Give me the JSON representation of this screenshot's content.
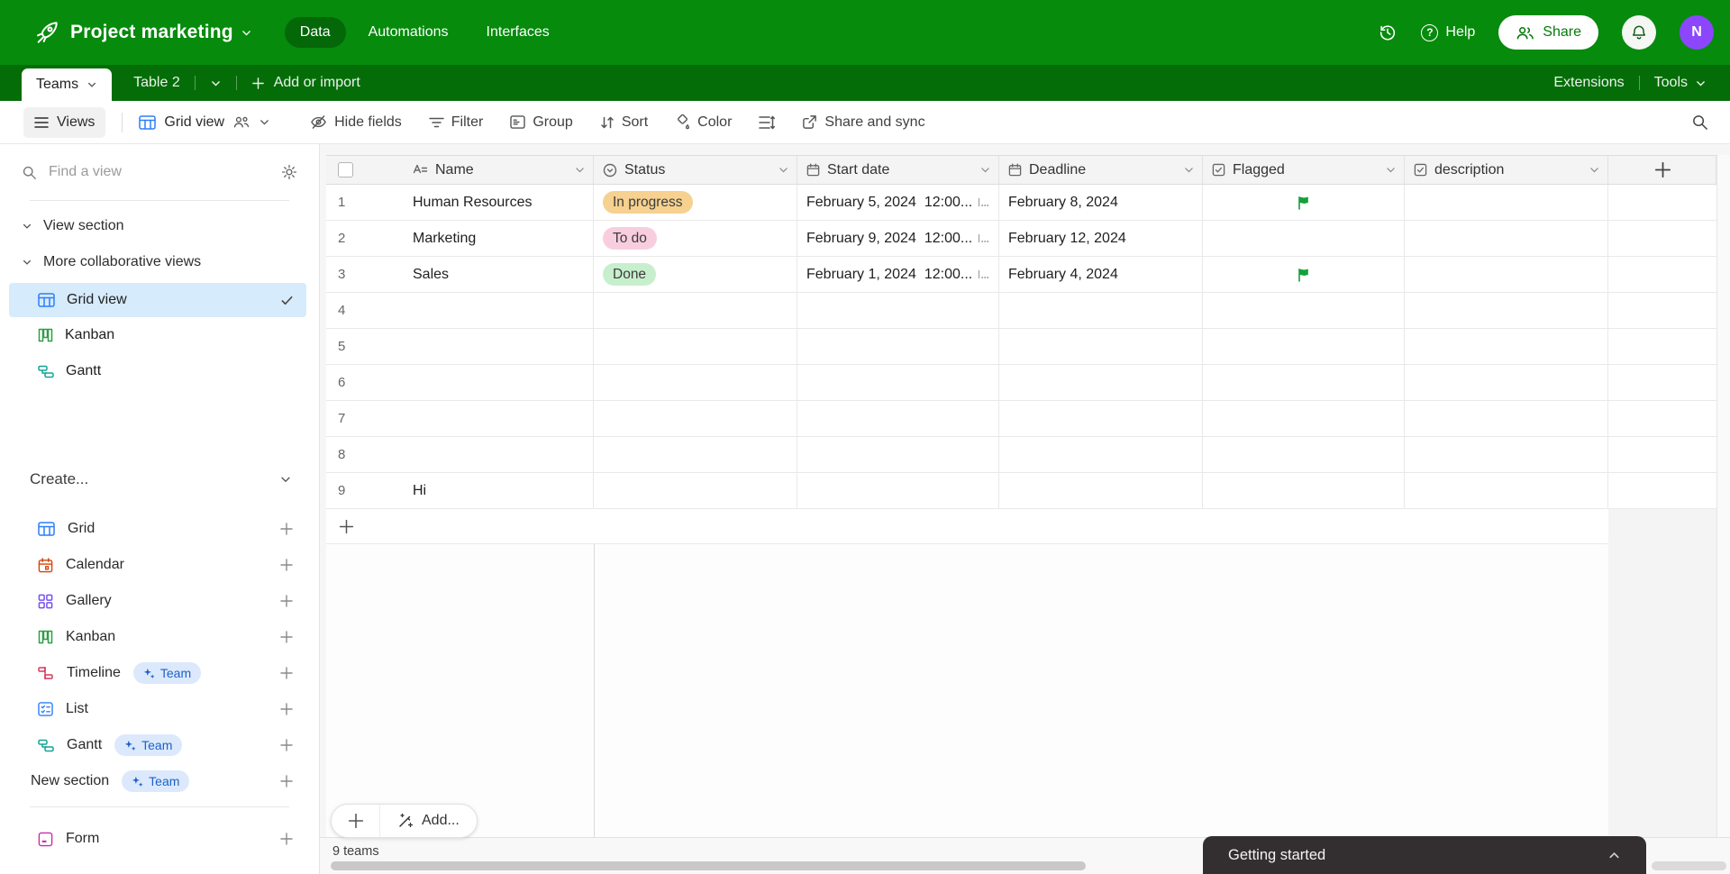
{
  "colors": {
    "topbar_green": "#068b0c",
    "tabbar_green": "#056d08",
    "selected_view_bg": "#d6ebfc",
    "status_in_progress_bg": "#f6d18f",
    "status_todo_bg": "#f8cede",
    "status_done_bg": "#c8efcd",
    "flag_green": "#15a03c",
    "avatar_purple": "#8b46fe",
    "team_badge_bg": "#dce9fc",
    "team_badge_text": "#1b61c9",
    "grid_icon_blue": "#2d7ff9",
    "kanban_icon_green": "#2f9e44",
    "gantt_icon_teal": "#12a594",
    "calendar_icon_orange": "#d54309",
    "gallery_icon_purple": "#7950f2",
    "timeline_icon_red": "#d6395f",
    "form_icon_magenta": "#cc2ab1"
  },
  "topbar": {
    "title": "Project marketing",
    "nav": [
      {
        "label": "Data",
        "active": true
      },
      {
        "label": "Automations",
        "active": false
      },
      {
        "label": "Interfaces",
        "active": false
      }
    ],
    "help_label": "Help",
    "share_label": "Share",
    "avatar_initial": "N"
  },
  "tabbar": {
    "active_table": "Teams",
    "second_table": "Table 2",
    "add_or_import_label": "Add or import",
    "extensions_label": "Extensions",
    "tools_label": "Tools"
  },
  "toolbar": {
    "views_label": "Views",
    "view_name": "Grid view",
    "hide_fields_label": "Hide fields",
    "filter_label": "Filter",
    "group_label": "Group",
    "sort_label": "Sort",
    "color_label": "Color",
    "share_sync_label": "Share and sync"
  },
  "sidebar": {
    "search_placeholder": "Find a view",
    "sections": [
      {
        "label": "View section"
      },
      {
        "label": "More collaborative views"
      }
    ],
    "views": [
      {
        "label": "Grid view",
        "selected": true
      },
      {
        "label": "Kanban",
        "selected": false
      },
      {
        "label": "Gantt",
        "selected": false
      }
    ],
    "create_label": "Create...",
    "create_items": [
      {
        "label": "Grid"
      },
      {
        "label": "Calendar"
      },
      {
        "label": "Gallery"
      },
      {
        "label": "Kanban"
      },
      {
        "label": "Timeline",
        "badge": "Team"
      },
      {
        "label": "List"
      },
      {
        "label": "Gantt",
        "badge": "Team"
      },
      {
        "label": "New section",
        "badge": "Team"
      },
      {
        "label": "Form"
      }
    ]
  },
  "table": {
    "columns": [
      "Name",
      "Status",
      "Start date",
      "Deadline",
      "Flagged",
      "description"
    ],
    "rows": [
      {
        "num": "1",
        "name": "Human Resources",
        "status": "In progress",
        "start_date": "February 5, 2024",
        "start_time": "12:00...",
        "deadline": "February 8, 2024",
        "flagged": true
      },
      {
        "num": "2",
        "name": "Marketing",
        "status": "To do",
        "start_date": "February 9, 2024",
        "start_time": "12:00...",
        "deadline": "February 12, 2024",
        "flagged": false
      },
      {
        "num": "3",
        "name": "Sales",
        "status": "Done",
        "start_date": "February 1, 2024",
        "start_time": "12:00...",
        "deadline": "February 4, 2024",
        "flagged": true
      },
      {
        "num": "4"
      },
      {
        "num": "5"
      },
      {
        "num": "6"
      },
      {
        "num": "7"
      },
      {
        "num": "8"
      },
      {
        "num": "9",
        "name": "Hi"
      }
    ],
    "footer": {
      "add_label": "Add...",
      "record_count": "9 teams"
    }
  },
  "toast": {
    "label": "Getting started"
  }
}
